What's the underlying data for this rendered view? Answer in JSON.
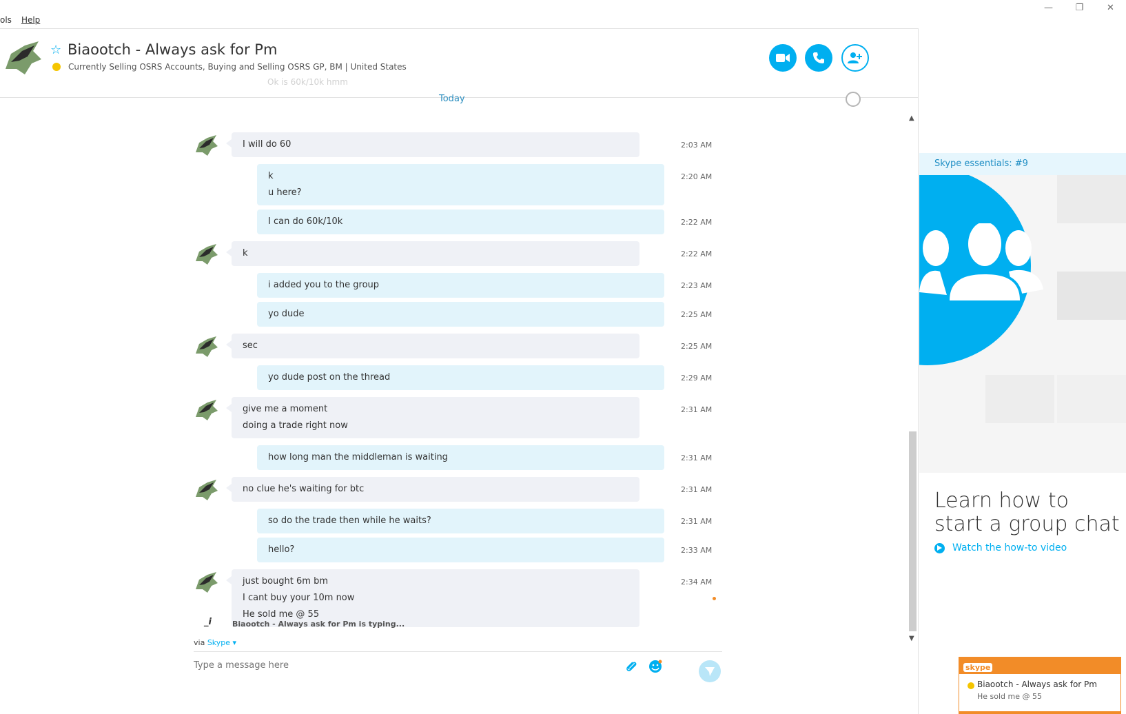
{
  "menu": {
    "items": [
      "ols",
      "Help"
    ]
  },
  "header": {
    "contact_name": "Biaootch - Always ask for Pm",
    "mood": "Currently Selling OSRS Accounts, Buying and Selling OSRS GP, BM  |  United States"
  },
  "chat": {
    "faded_preview": "Ok is 60k/10k hmm",
    "day_label": "Today",
    "messages": [
      {
        "from": "them",
        "lines": [
          "I will do 60"
        ],
        "time": "2:03 AM"
      },
      {
        "from": "me",
        "lines": [
          "k",
          "u here?"
        ],
        "time": "2:20 AM"
      },
      {
        "from": "me",
        "lines": [
          "I can do 60k/10k"
        ],
        "time": "2:22 AM"
      },
      {
        "from": "them",
        "lines": [
          "k"
        ],
        "time": "2:22 AM"
      },
      {
        "from": "me",
        "lines": [
          "i added you to the group"
        ],
        "time": "2:23 AM"
      },
      {
        "from": "me",
        "lines": [
          "yo dude"
        ],
        "time": "2:25 AM"
      },
      {
        "from": "them",
        "lines": [
          "sec"
        ],
        "time": "2:25 AM"
      },
      {
        "from": "me",
        "lines": [
          "yo dude post on the thread"
        ],
        "time": "2:29 AM"
      },
      {
        "from": "them",
        "lines": [
          "give me a moment",
          "doing a trade right now"
        ],
        "time": "2:31 AM"
      },
      {
        "from": "me",
        "lines": [
          "how long man the middleman is waiting"
        ],
        "time": "2:31 AM"
      },
      {
        "from": "them",
        "lines": [
          "no clue he's waiting for btc"
        ],
        "time": "2:31 AM"
      },
      {
        "from": "me",
        "lines": [
          "so do the trade then while he waits?"
        ],
        "time": "2:31 AM"
      },
      {
        "from": "me",
        "lines": [
          "hello?"
        ],
        "time": "2:33 AM"
      },
      {
        "from": "them",
        "lines": [
          "just bought 6m bm",
          "I cant buy your 10m now",
          "He sold me @ 55"
        ],
        "time": "2:34 AM"
      }
    ],
    "typing_icon": "_i",
    "typing_text": "Biaootch - Always ask for Pm is typing..."
  },
  "composer": {
    "via_prefix": "via",
    "via_service": "Skype",
    "placeholder": "Type a message here"
  },
  "sidebar": {
    "essentials_label": "Skype essentials: #9",
    "headline": "Learn how to start a group chat",
    "watch_link": "Watch the how-to video"
  },
  "toast": {
    "logo": "skype",
    "title": "Biaootch - Always ask for Pm",
    "body": "He sold me @ 55"
  },
  "colors": {
    "accent": "#00aff0",
    "incoming_bubble": "#eff1f6",
    "outgoing_bubble": "#e2f4fb",
    "notification": "#f28c28",
    "away_status": "#f5c500"
  }
}
